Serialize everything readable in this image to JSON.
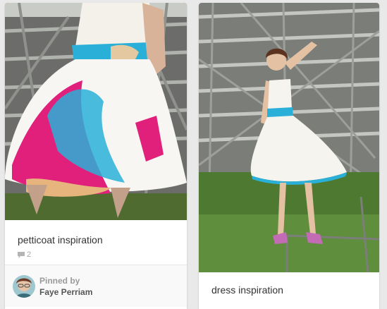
{
  "pins": [
    {
      "description": "petticoat inspiration",
      "comment_count": "2",
      "pinned_by_label": "Pinned by",
      "pinner_name": "Faye Perriam"
    },
    {
      "description": "dress inspiration"
    }
  ],
  "colors": {
    "page_bg": "#e9e9e9",
    "card_bg": "#ffffff",
    "accent_blue": "#2ab0d8",
    "accent_pink": "#e0207a"
  },
  "icons": [
    "comment-icon"
  ]
}
